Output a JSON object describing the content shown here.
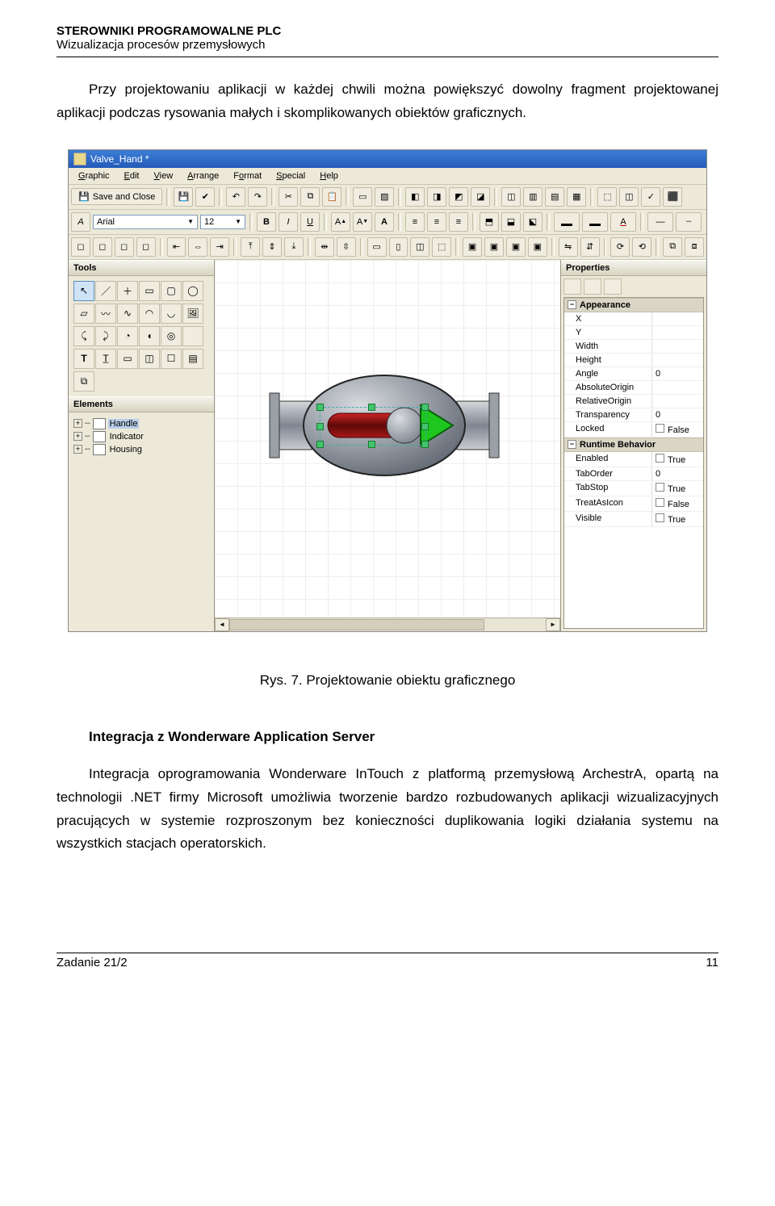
{
  "doc": {
    "header_title": "STEROWNIKI PROGRAMOWALNE PLC",
    "header_sub": "Wizualizacja procesów przemysłowych",
    "intro": "Przy projektowaniu aplikacji w każdej chwili można powiększyć dowolny fragment projektowanej aplikacji podczas rysowania małych i skomplikowanych obiektów graficznych.",
    "caption": "Rys. 7. Projektowanie obiektu graficznego",
    "section_title": "Integracja z Wonderware Application Server",
    "section_body": "Integracja oprogramowania Wonderware InTouch z platformą przemysłową ArchestrA, opartą na technologii .NET firmy Microsoft umożliwia tworzenie bardzo rozbudowanych aplikacji wizualizacyjnych pracujących w systemie rozproszonym bez konieczności duplikowania logiki działania systemu na wszystkich stacjach operatorskich.",
    "footer_left": "Zadanie 21/2",
    "footer_right": "11"
  },
  "app": {
    "title": "Valve_Hand *",
    "menu": [
      "Graphic",
      "Edit",
      "View",
      "Arrange",
      "Format",
      "Special",
      "Help"
    ],
    "save_close": "Save and Close",
    "font": "Arial",
    "fontsize": "12",
    "format_buttons": [
      "B",
      "I",
      "U",
      "A",
      "A",
      "A"
    ],
    "panels": {
      "tools": "Tools",
      "elements": "Elements",
      "properties": "Properties"
    },
    "elements": [
      {
        "label": "Handle",
        "selected": true
      },
      {
        "label": "Indicator",
        "selected": false
      },
      {
        "label": "Housing",
        "selected": false
      }
    ],
    "prop_groups": [
      {
        "name": "Appearance",
        "rows": [
          {
            "k": "X",
            "v": ""
          },
          {
            "k": "Y",
            "v": ""
          },
          {
            "k": "Width",
            "v": ""
          },
          {
            "k": "Height",
            "v": ""
          },
          {
            "k": "Angle",
            "v": "0"
          },
          {
            "k": "AbsoluteOrigin",
            "v": ""
          },
          {
            "k": "RelativeOrigin",
            "v": ""
          },
          {
            "k": "Transparency",
            "v": "0"
          },
          {
            "k": "Locked",
            "v": "False",
            "cb": true
          }
        ]
      },
      {
        "name": "Runtime Behavior",
        "rows": [
          {
            "k": "Enabled",
            "v": "True",
            "cb": true
          },
          {
            "k": "TabOrder",
            "v": "0"
          },
          {
            "k": "TabStop",
            "v": "True",
            "cb": true
          },
          {
            "k": "TreatAsIcon",
            "v": "False",
            "cb": true
          },
          {
            "k": "Visible",
            "v": "True",
            "cb": true
          }
        ]
      }
    ]
  }
}
